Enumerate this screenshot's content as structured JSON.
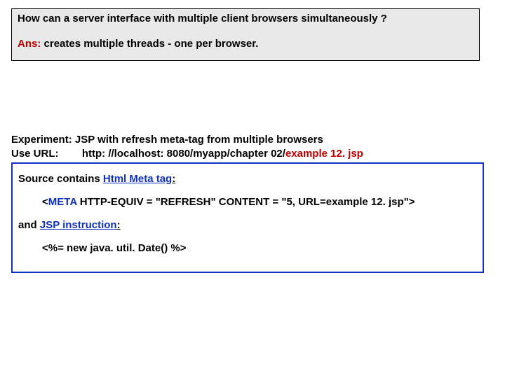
{
  "qa": {
    "question": "How can a server interface with multiple client browsers simultaneously ?",
    "ans_label": "Ans:",
    "answer_text": "  creates multiple threads - one per browser."
  },
  "experiment": {
    "line1_label": "Experiment:",
    "line1_text": "  JSP with refresh meta-tag from multiple browsers",
    "line2_label": "Use URL:",
    "line2_pad": "        ",
    "url_black": "http: //localhost: 8080/myapp/chapter 02/",
    "url_red": "example 12. jsp"
  },
  "source": {
    "contains_prefix": "Source contains ",
    "html_meta_tag": "Html Meta tag",
    "colon": ":",
    "meta_open": "<",
    "meta_tagname": "META",
    "meta_rest": "  HTTP-EQUIV = \"REFRESH\" CONTENT = \"5, URL=example 12. jsp\">",
    "and_text": "and ",
    "jsp_instruction": "JSP instruction",
    "jsp_code": "<%= new java. util. Date() %>"
  }
}
